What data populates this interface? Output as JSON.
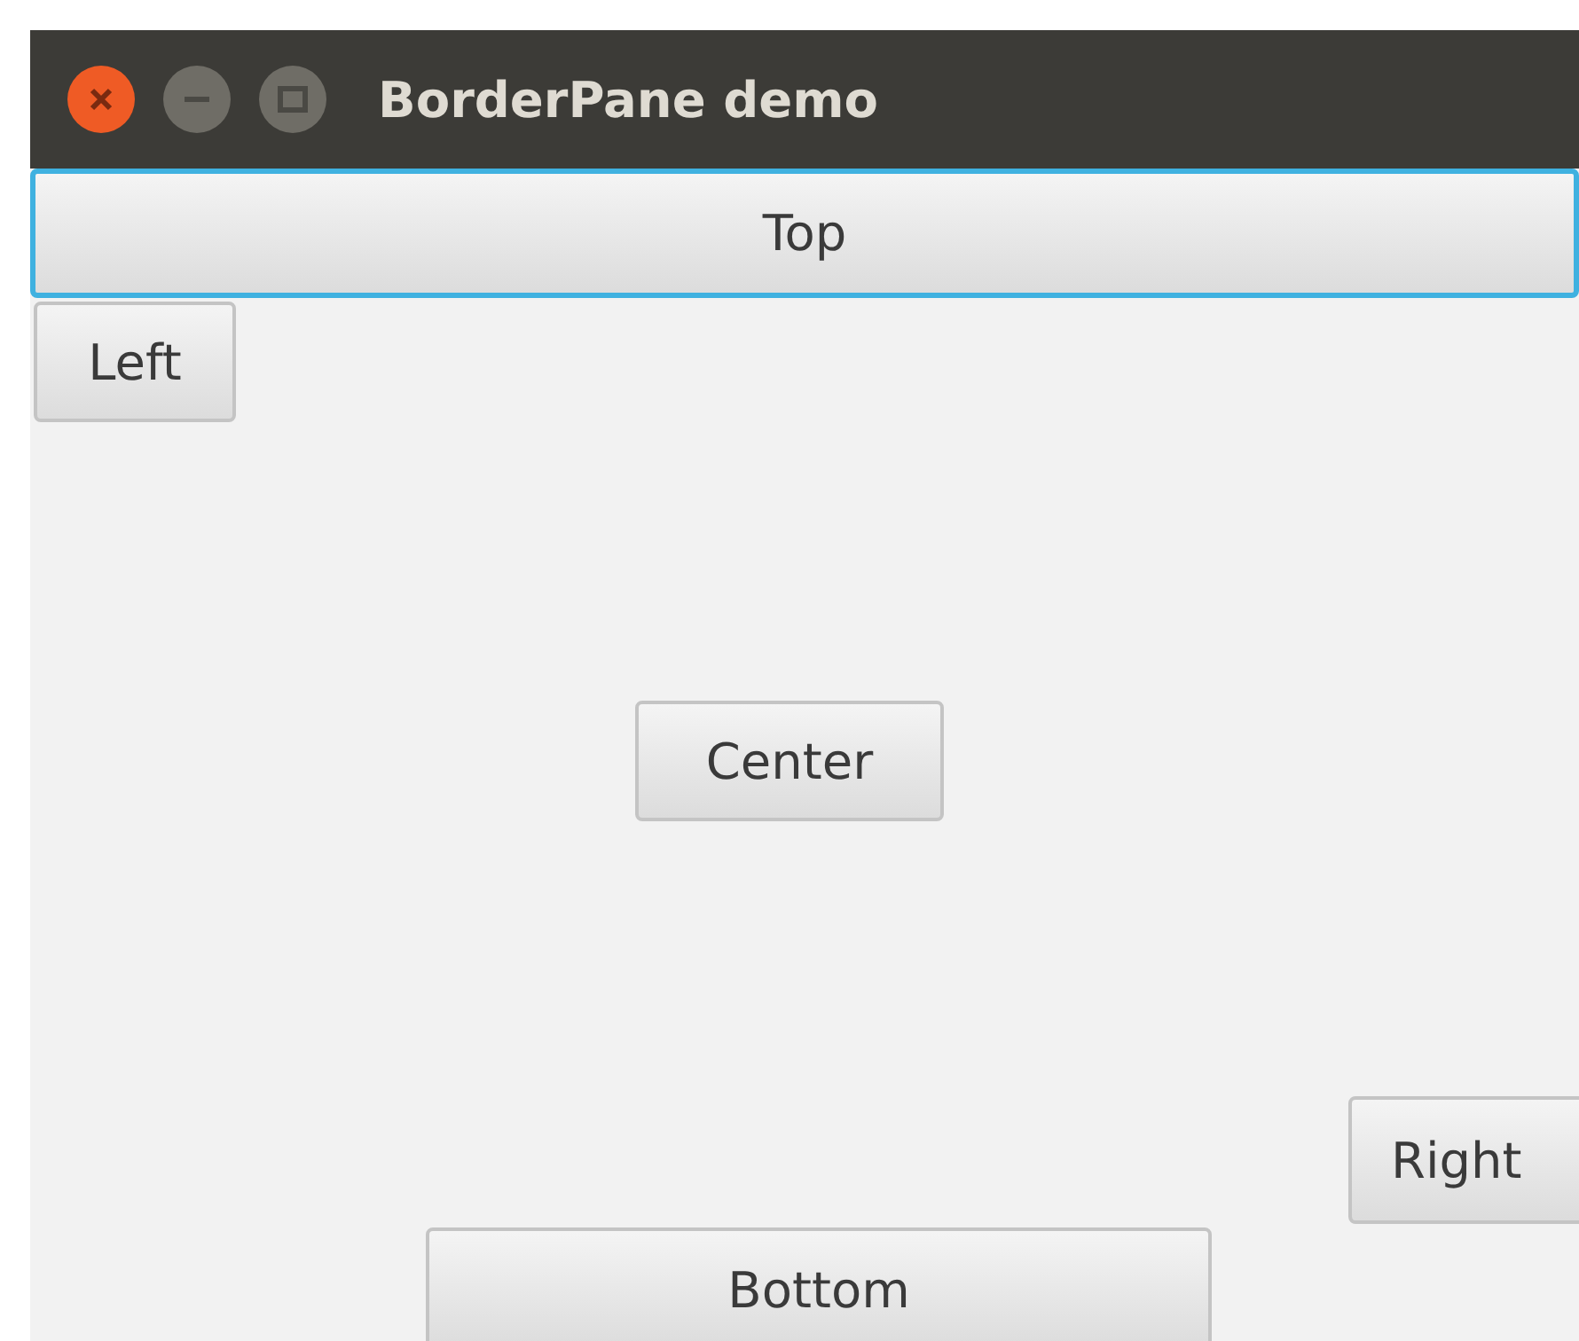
{
  "window": {
    "title": "BorderPane demo"
  },
  "buttons": [
    {
      "kind": "top",
      "label": "Top",
      "focused": true
    },
    {
      "kind": "left",
      "label": "Left",
      "focused": false
    },
    {
      "kind": "center",
      "label": "Center",
      "focused": false
    },
    {
      "kind": "right",
      "label": "Right",
      "focused": false
    },
    {
      "kind": "bottom",
      "label": "Bottom",
      "focused": false
    }
  ]
}
